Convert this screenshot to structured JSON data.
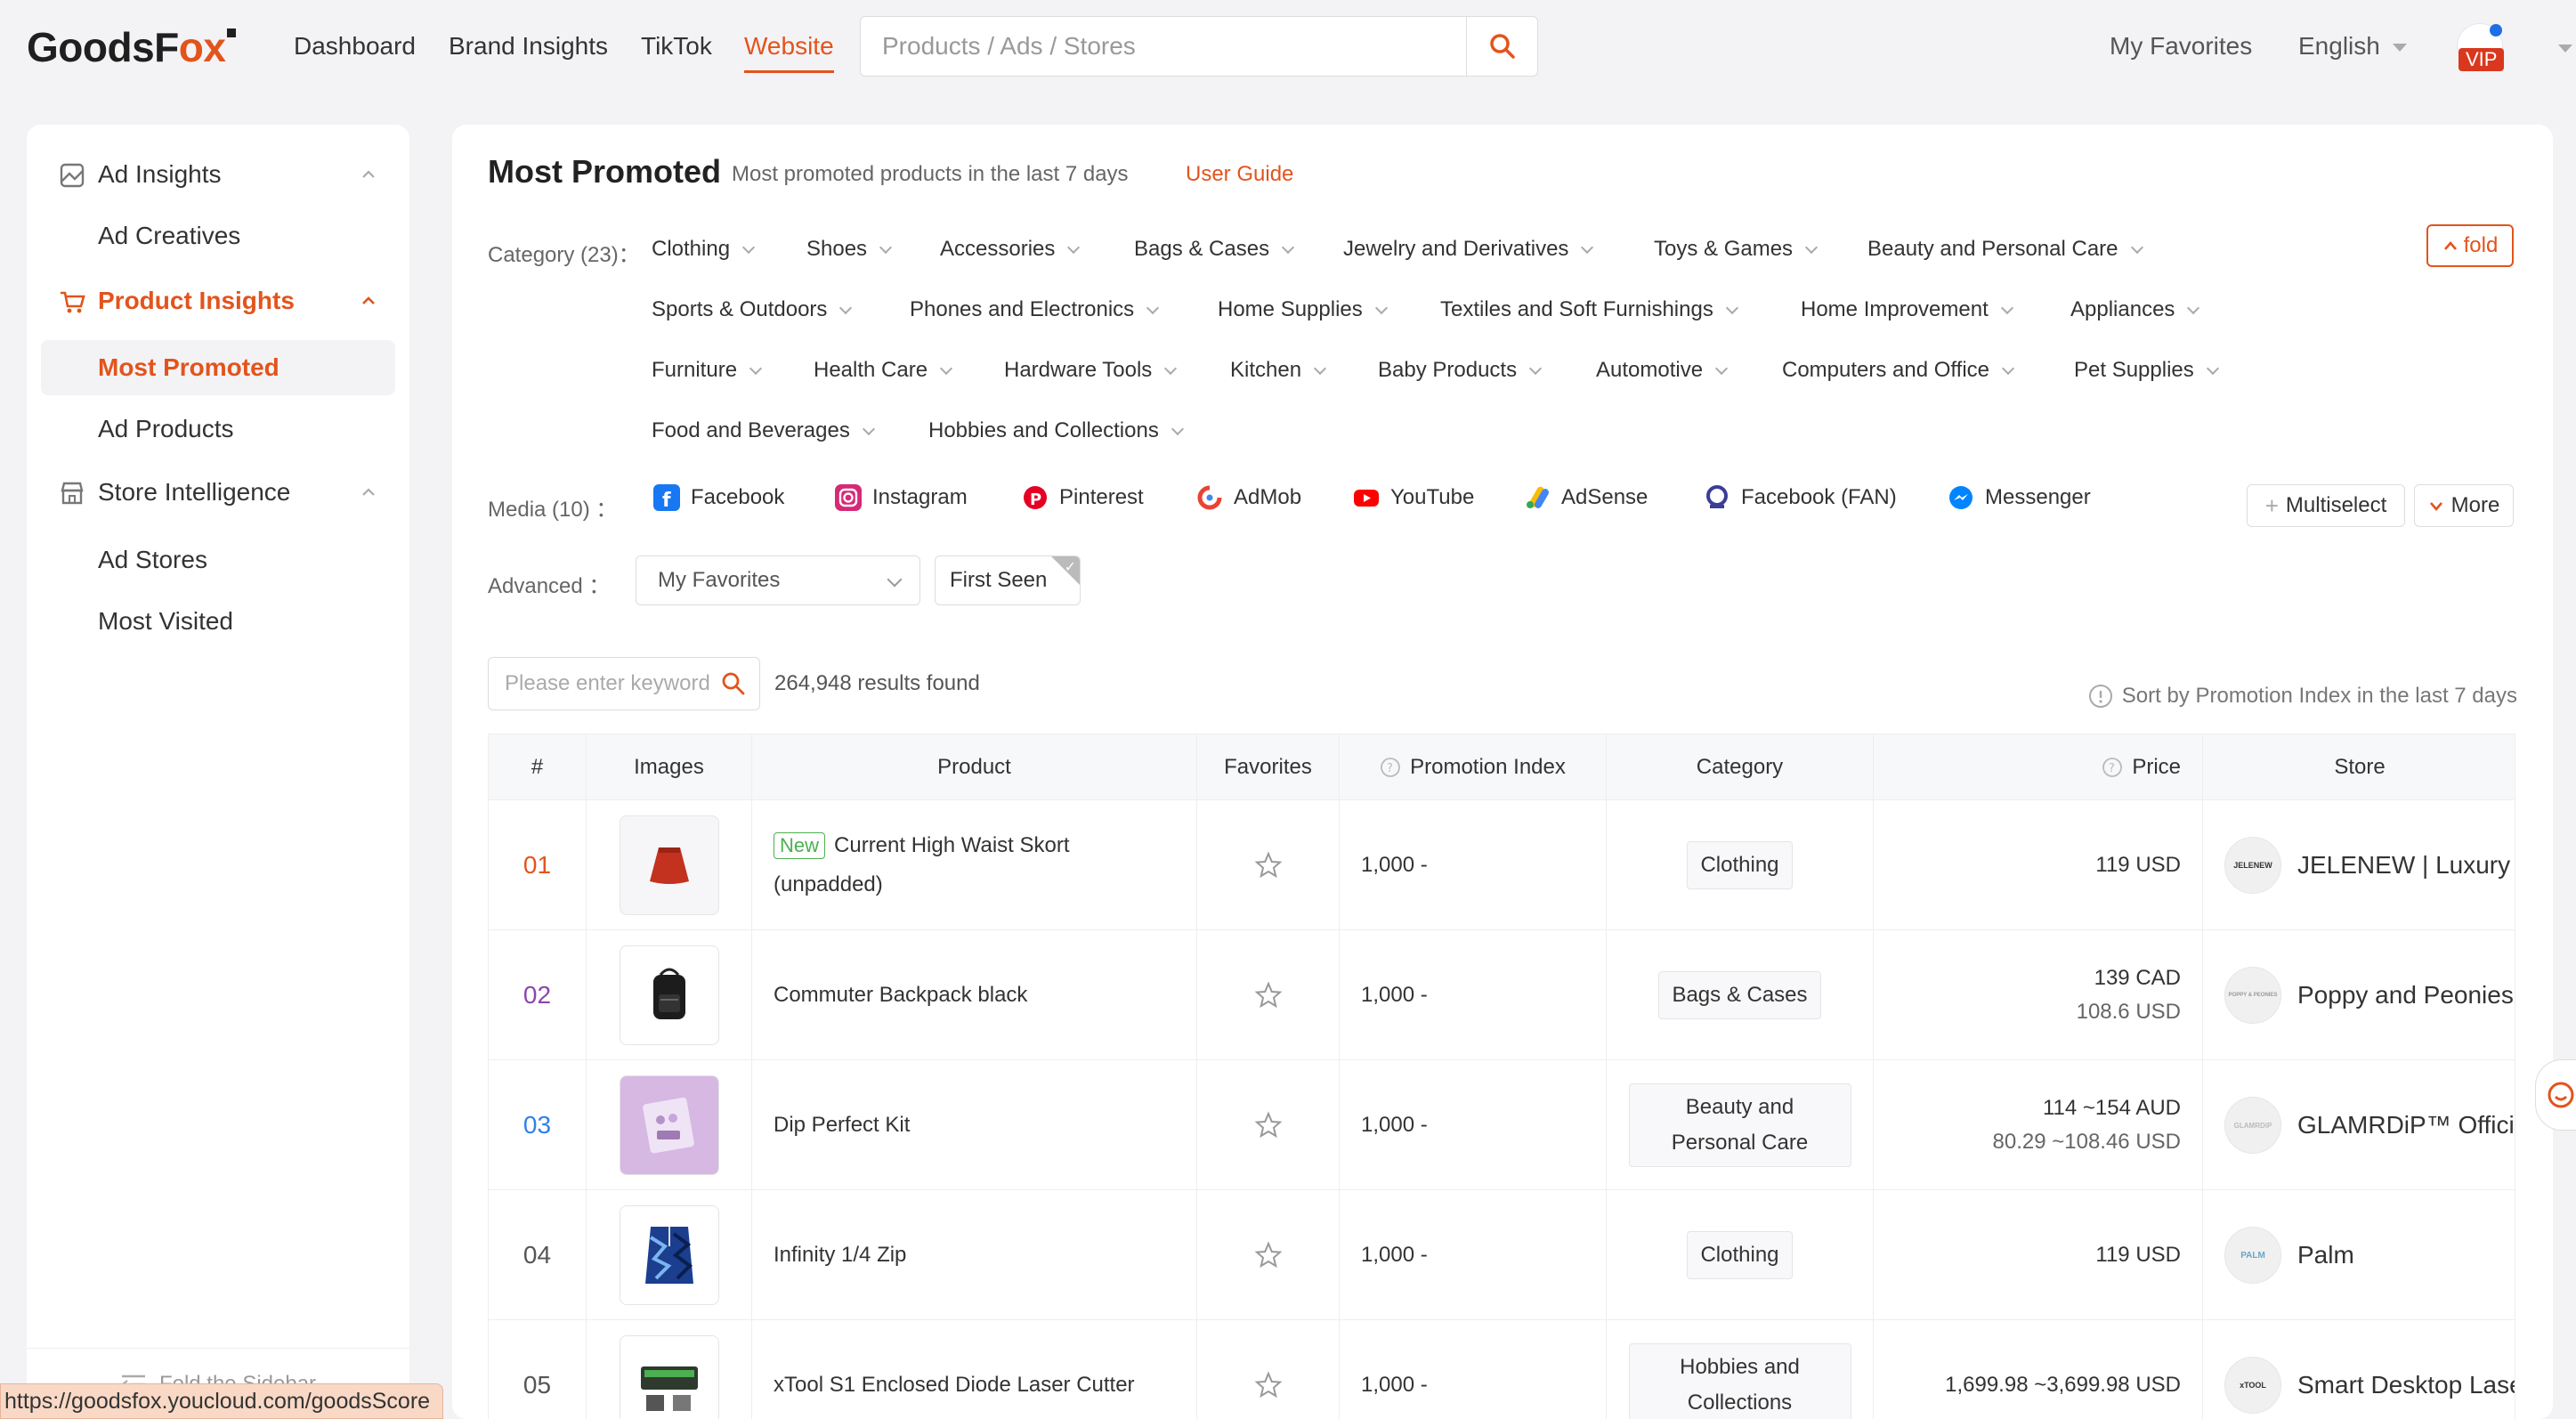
{
  "brand": {
    "name_start": "GoodsF",
    "name_ox": "ox"
  },
  "nav": {
    "dashboard": "Dashboard",
    "brand_insights": "Brand Insights",
    "tiktok": "TikTok",
    "website": "Website"
  },
  "search": {
    "placeholder": "Products / Ads / Stores"
  },
  "topright": {
    "favorites": "My Favorites",
    "language": "English",
    "vip": "VIP"
  },
  "sidebar": {
    "ad_insights": "Ad Insights",
    "ad_creatives": "Ad Creatives",
    "product_insights": "Product Insights",
    "most_promoted": "Most Promoted",
    "ad_products": "Ad Products",
    "store_intelligence": "Store Intelligence",
    "ad_stores": "Ad Stores",
    "most_visited": "Most Visited",
    "fold": "Fold the Sidebar"
  },
  "status_url": "https://goodsfox.youcloud.com/goodsScore",
  "page": {
    "title": "Most Promoted",
    "subtitle": "Most promoted products in the last 7 days",
    "guide": "User Guide",
    "category_label": "Category (23)：",
    "fold": "fold",
    "media_label": "Media (10) ：",
    "advanced_label": "Advanced ：",
    "advanced_select": "My Favorites",
    "first_seen": "First Seen",
    "keyword_placeholder": "Please enter keywords",
    "results": "264,948 results found",
    "sort": "Sort by Promotion Index in the last 7 days",
    "multiselect": "Multiselect",
    "more": "More"
  },
  "categories": [
    "Clothing",
    "Shoes",
    "Accessories",
    "Bags & Cases",
    "Jewelry and Derivatives",
    "Toys & Games",
    "Beauty and Personal Care",
    "Sports & Outdoors",
    "Phones and Electronics",
    "Home Supplies",
    "Textiles and Soft Furnishings",
    "Home Improvement",
    "Appliances",
    "Furniture",
    "Health Care",
    "Hardware Tools",
    "Kitchen",
    "Baby Products",
    "Automotive",
    "Computers and Office",
    "Pet Supplies",
    "Food and Beverages",
    "Hobbies and Collections"
  ],
  "media": [
    "Facebook",
    "Instagram",
    "Pinterest",
    "AdMob",
    "YouTube",
    "AdSense",
    "Facebook (FAN)",
    "Messenger"
  ],
  "table": {
    "headers": [
      "#",
      "Images",
      "Product",
      "Favorites",
      "Promotion Index",
      "Category",
      "Price",
      "Store"
    ],
    "rows": [
      {
        "rank": "01",
        "tag": "New",
        "product": "Current High Waist Skort (unpadded)",
        "index": "1,000 -",
        "category": "Clothing",
        "price1": "119 USD",
        "price2": "",
        "store_logo": "JELENEW",
        "store": "JELENEW | Luxury H",
        "rank_color": "#e2541c"
      },
      {
        "rank": "02",
        "tag": "",
        "product": "Commuter Backpack black",
        "index": "1,000 -",
        "category": "Bags & Cases",
        "price1": "139 CAD",
        "price2": "108.6 USD",
        "store_logo": "POPPY & PEONIES",
        "store": "Poppy and Peonies",
        "rank_color": "#8e44ad"
      },
      {
        "rank": "03",
        "tag": "",
        "product": "Dip Perfect Kit",
        "index": "1,000 -",
        "category": "Beauty and Personal Care",
        "price1": "114 ~154 AUD",
        "price2": "80.29 ~108.46 USD",
        "store_logo": "GLAMRDiP",
        "store": "GLAMRDiP™ Official",
        "rank_color": "#2f80ed"
      },
      {
        "rank": "04",
        "tag": "",
        "product": "Infinity 1/4 Zip",
        "index": "1,000 -",
        "category": "Clothing",
        "price1": "119 USD",
        "price2": "",
        "store_logo": "PALM",
        "store": "Palm",
        "rank_color": "#555555"
      },
      {
        "rank": "05",
        "tag": "",
        "product": "xTool S1 Enclosed Diode Laser Cutter",
        "index": "1,000 -",
        "category": "Hobbies and Collections",
        "price1": "1,699.98 ~3,699.98 USD",
        "price2": "",
        "store_logo": "xTOOL",
        "store": "Smart Desktop Lase",
        "rank_color": "#555555"
      }
    ]
  },
  "colors": {
    "accent": "#e2541c",
    "vip": "#d9381e",
    "new_tag": "#4caf50"
  }
}
